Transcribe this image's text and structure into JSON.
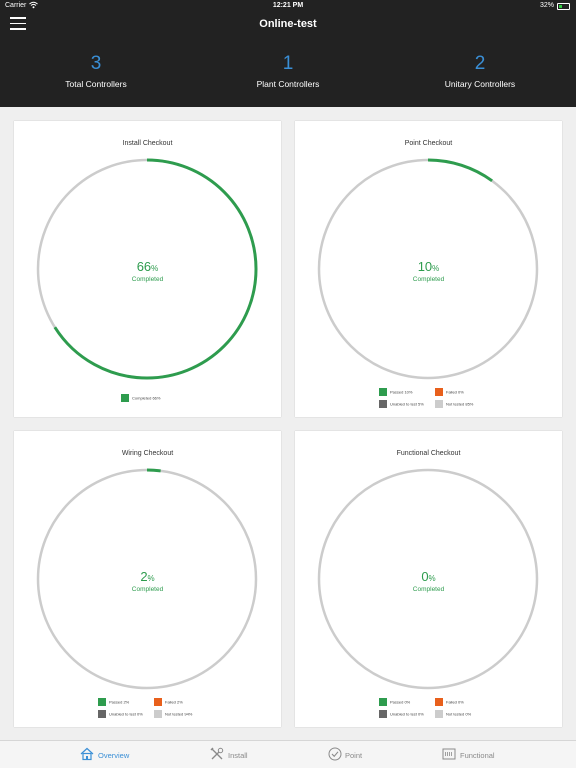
{
  "status_bar": {
    "carrier": "Carrier",
    "time": "12:21 PM",
    "battery": "32%"
  },
  "header": {
    "title": "Online-test",
    "stats": [
      {
        "value": "3",
        "label": "Total Controllers"
      },
      {
        "value": "1",
        "label": "Plant Controllers"
      },
      {
        "value": "2",
        "label": "Unitary Controllers"
      }
    ]
  },
  "cards": {
    "install": {
      "title": "Install Checkout",
      "percent": "66",
      "percent_unit": "%",
      "completed_label": "Completed",
      "progress_fraction": 0.66,
      "legend": [
        {
          "label": "Completed 66%",
          "color": "#2e9c4e"
        }
      ]
    },
    "point": {
      "title": "Point Checkout",
      "percent": "10",
      "percent_unit": "%",
      "completed_label": "Completed",
      "progress_fraction": 0.1,
      "legend": [
        {
          "label": "Passed 10%",
          "color": "#2e9c4e"
        },
        {
          "label": "Failed 0%",
          "color": "#e8601c"
        },
        {
          "label": "Unabled to test 5%",
          "color": "#666666"
        },
        {
          "label": "Not tested 85%",
          "color": "#cccccc"
        }
      ]
    },
    "wiring": {
      "title": "Wiring Checkout",
      "percent": "2",
      "percent_unit": "%",
      "completed_label": "Completed",
      "progress_fraction": 0.02,
      "legend": [
        {
          "label": "Passed 2%",
          "color": "#2e9c4e"
        },
        {
          "label": "Failed 2%",
          "color": "#e8601c"
        },
        {
          "label": "Unabled to test 0%",
          "color": "#666666"
        },
        {
          "label": "Not tested 94%",
          "color": "#cccccc"
        }
      ]
    },
    "functional": {
      "title": "Functional Checkout",
      "percent": "0",
      "percent_unit": "%",
      "completed_label": "Completed",
      "progress_fraction": 0.0,
      "legend": [
        {
          "label": "Passed 0%",
          "color": "#2e9c4e"
        },
        {
          "label": "Failed 0%",
          "color": "#e8601c"
        },
        {
          "label": "Unabled to test 0%",
          "color": "#666666"
        },
        {
          "label": "Not tested 0%",
          "color": "#cccccc"
        }
      ]
    }
  },
  "tabbar": {
    "tabs": [
      {
        "label": "Overview",
        "icon": "home-icon",
        "active": true
      },
      {
        "label": "Install",
        "icon": "tools-icon",
        "active": false
      },
      {
        "label": "Point",
        "icon": "checkmark-circle-icon",
        "active": false
      },
      {
        "label": "Functional",
        "icon": "function-box-icon",
        "active": false
      }
    ]
  },
  "colors": {
    "accent": "#3a8fd6",
    "progress": "#2e9c4e",
    "track": "#cccccc",
    "header_bg": "#222222"
  }
}
